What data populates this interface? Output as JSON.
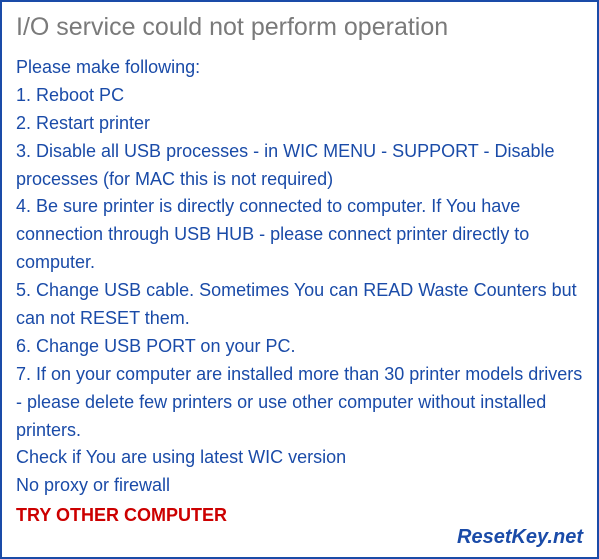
{
  "title": "I/O service could not perform operation",
  "intro": "Please make following:",
  "steps": [
    "1. Reboot PC",
    "2. Restart printer",
    "3. Disable all USB processes - in WIC MENU - SUPPORT - Disable processes (for MAC this is not required)",
    "4. Be sure printer is directly connected to computer. If You have connection through USB HUB - please connect printer directly to computer.",
    "5. Change USB cable. Sometimes You can READ Waste Counters but can not RESET them.",
    "6. Change USB PORT on your PC.",
    "7. If on your computer are installed more than 30 printer models drivers - please delete few printers or use other computer without installed printers."
  ],
  "notes": [
    "Check if You are using latest WIC version",
    "No proxy or firewall"
  ],
  "try_other": "TRY OTHER COMPUTER",
  "footer": "ResetKey.net"
}
